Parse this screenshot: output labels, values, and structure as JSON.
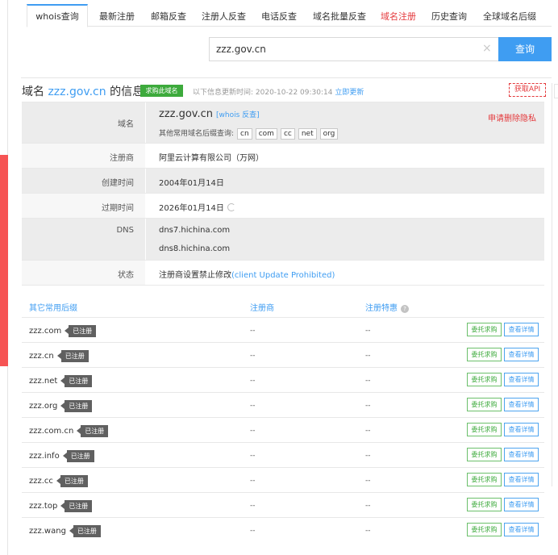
{
  "left_tag": {
    "text": ""
  },
  "tabs": [
    {
      "label": "whois查询",
      "active": true,
      "red": false
    },
    {
      "label": "最新注册",
      "active": false,
      "red": false
    },
    {
      "label": "邮箱反查",
      "active": false,
      "red": false
    },
    {
      "label": "注册人反查",
      "active": false,
      "red": false
    },
    {
      "label": "电话反查",
      "active": false,
      "red": false
    },
    {
      "label": "域名批量反查",
      "active": false,
      "red": false
    },
    {
      "label": "域名注册",
      "active": false,
      "red": true
    },
    {
      "label": "历史查询",
      "active": false,
      "red": false
    },
    {
      "label": "全球域名后缀",
      "active": false,
      "red": false
    }
  ],
  "search": {
    "value": "zzz.gov.cn",
    "button_label": "查询",
    "clear_glyph": "×"
  },
  "heading": {
    "prefix": "域名 ",
    "domain": "zzz.gov.cn",
    "suffix": " 的信息",
    "buy_badge": "求购此域名",
    "update_label": "以下信息更新时间: 2020-10-22 09:30:14",
    "update_link": "立即更新",
    "api_button": "获取API"
  },
  "info": {
    "domain_label": "域名",
    "domain_value": "zzz.gov.cn",
    "whois_reverse": "[whois 反查]",
    "delete_privacy": "申请删除隐私",
    "other_suffix_label": "其他常用域名后缀查询:",
    "suffixes": [
      "cn",
      "com",
      "cc",
      "net",
      "org"
    ],
    "registrar_label": "注册商",
    "registrar_value": "阿里云计算有限公司（万网）",
    "created_label": "创建时间",
    "created_value": "2004年01月14日",
    "expire_label": "过期时间",
    "expire_value": "2026年01月14日",
    "dns_label": "DNS",
    "dns_values": [
      "dns7.hichina.com",
      "dns8.hichina.com"
    ],
    "status_label": "状态",
    "status_value": "注册商设置禁止修改",
    "status_en": "(client Update Prohibited)"
  },
  "suffix_table": {
    "headers": [
      "其它常用后缀",
      "注册商",
      "注册特惠"
    ],
    "qmark": "?",
    "rows": [
      {
        "domain": "zzz.com",
        "tag": "已注册",
        "registrar": "--",
        "promo": "--",
        "btn1": "委托求购",
        "btn2": "查看详情"
      },
      {
        "domain": "zzz.cn",
        "tag": "已注册",
        "registrar": "--",
        "promo": "--",
        "btn1": "委托求购",
        "btn2": "查看详情"
      },
      {
        "domain": "zzz.net",
        "tag": "已注册",
        "registrar": "--",
        "promo": "--",
        "btn1": "委托求购",
        "btn2": "查看详情"
      },
      {
        "domain": "zzz.org",
        "tag": "已注册",
        "registrar": "--",
        "promo": "--",
        "btn1": "委托求购",
        "btn2": "查看详情"
      },
      {
        "domain": "zzz.com.cn",
        "tag": "已注册",
        "registrar": "--",
        "promo": "--",
        "btn1": "委托求购",
        "btn2": "查看详情"
      },
      {
        "domain": "zzz.info",
        "tag": "已注册",
        "registrar": "--",
        "promo": "--",
        "btn1": "委托求购",
        "btn2": "查看详情"
      },
      {
        "domain": "zzz.cc",
        "tag": "已注册",
        "registrar": "--",
        "promo": "--",
        "btn1": "委托求购",
        "btn2": "查看详情"
      },
      {
        "domain": "zzz.top",
        "tag": "已注册",
        "registrar": "--",
        "promo": "--",
        "btn1": "委托求购",
        "btn2": "查看详情"
      },
      {
        "domain": "zzz.wang",
        "tag": "已注册",
        "registrar": "--",
        "promo": "--",
        "btn1": "委托求购",
        "btn2": "查看详情"
      }
    ]
  },
  "colors": {
    "accent": "#3f9df2",
    "danger": "#e4393c",
    "success": "#3daa3c",
    "tag": "#606060"
  }
}
